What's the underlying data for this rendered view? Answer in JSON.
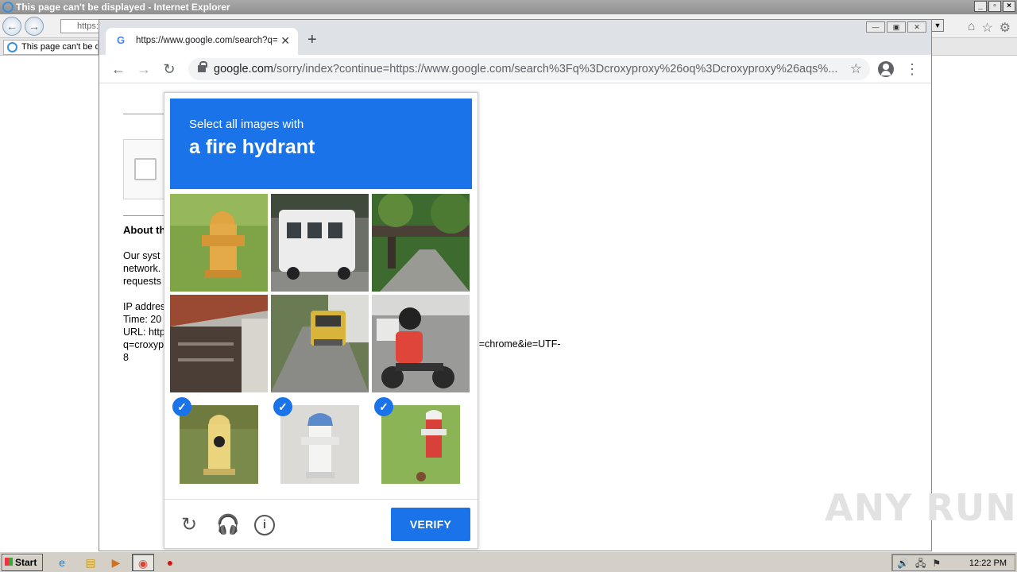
{
  "ie": {
    "title": "This page can't be displayed - Internet Explorer",
    "address_partial": "https:",
    "tab_label": "This page can't be d"
  },
  "chrome": {
    "tab_title": "https://www.google.com/search?q=",
    "url_host": "google.com",
    "url_path": "/sorry/index?continue=https://www.google.com/search%3Fq%3Dcroxyproxy%26oq%3Dcroxyproxy%26aqs%..."
  },
  "page": {
    "about_title": "About th",
    "para1": [
      "Our syst",
      "network.",
      "requests"
    ],
    "para2": [
      "IP addres",
      "Time: 20",
      "URL: http",
      "q=croxyp",
      "8"
    ],
    "url_tail": "l=chrome&ie=UTF-"
  },
  "captcha": {
    "prompt_line1": "Select all images with",
    "prompt_target": "a fire hydrant",
    "verify_label": "VERIFY",
    "tiles": [
      {
        "subject": "yellow fire hydrant on grass",
        "selected": false
      },
      {
        "subject": "white bus on street",
        "selected": false
      },
      {
        "subject": "tree lined road with bridge",
        "selected": false
      },
      {
        "subject": "tiled roof and gate",
        "selected": false
      },
      {
        "subject": "yellow truck on road",
        "selected": false
      },
      {
        "subject": "person on motorcycle",
        "selected": false
      },
      {
        "subject": "yellow fire hydrant",
        "selected": true
      },
      {
        "subject": "white and blue fire hydrant",
        "selected": true
      },
      {
        "subject": "red and white fire hydrant",
        "selected": true
      }
    ],
    "colors": {
      "accent": "#1a73e8"
    }
  },
  "watermark": "ANY RUN",
  "taskbar": {
    "start_label": "Start",
    "clock": "12:22 PM"
  }
}
